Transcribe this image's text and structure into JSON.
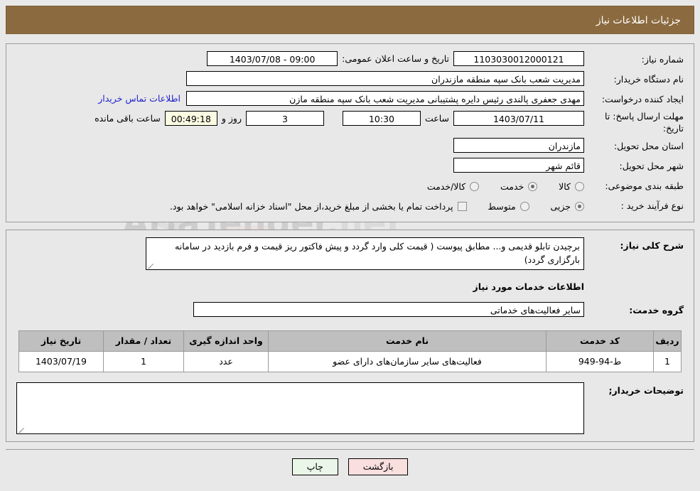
{
  "header": {
    "title": "جزئیات اطلاعات نیاز"
  },
  "form": {
    "need_number_label": "شماره نیاز:",
    "need_number_value": "1103030012000121",
    "announce_label": "تاریخ و ساعت اعلان عمومی:",
    "announce_value": "09:00 - 1403/07/08",
    "org_label": "نام دستگاه خریدار:",
    "org_value": "مدیریت شعب بانک سپه منطقه مازندران",
    "creator_label": "ایجاد کننده درخواست:",
    "creator_value": "مهدی جعفری پالندی رئیس دایره پشتیبانی مدیریت شعب بانک سپه منطقه مازن",
    "creator_link": "اطلاعات تماس خریدار",
    "deadline_label": "مهلت ارسال پاسخ: تا تاریخ:",
    "deadline_date": "1403/07/11",
    "deadline_time_label": "ساعت",
    "deadline_time": "10:30",
    "days_value": "3",
    "days_label": "روز و",
    "countdown_value": "00:49:18",
    "countdown_label": "ساعت باقی مانده",
    "province_label": "استان محل تحویل:",
    "province_value": "مازندران",
    "city_label": "شهر محل تحویل:",
    "city_value": "قائم شهر",
    "category_label": "طبقه بندی موضوعی:",
    "category_options": [
      {
        "label": "کالا",
        "selected": false
      },
      {
        "label": "خدمت",
        "selected": true
      },
      {
        "label": "کالا/خدمت",
        "selected": false
      }
    ],
    "process_label": "نوع فرآیند خرید :",
    "process_options": [
      {
        "label": "جزیی",
        "selected": true
      },
      {
        "label": "متوسط",
        "selected": false
      }
    ],
    "treasury_checkbox_label": "",
    "treasury_note": "پرداخت تمام یا بخشی از مبلغ خرید،از محل \"اسناد خزانه اسلامی\" خواهد بود."
  },
  "description": {
    "label": "شرح کلی نیاز:",
    "value": "برچیدن تابلو  قدیمی و... مطابق پیوست ( قیمت کلی وارد گردد و پیش فاکتور ریز قیمت و فرم بازدید در سامانه بارگزاری گردد)"
  },
  "services_section": {
    "title": "اطلاعات خدمات مورد نیاز",
    "group_label": "گروه خدمت:",
    "group_value": "سایر فعالیت‌های خدماتی"
  },
  "table": {
    "columns": [
      "ردیف",
      "کد خدمت",
      "نام خدمت",
      "واحد اندازه گیری",
      "تعداد / مقدار",
      "تاریخ نیاز"
    ],
    "rows": [
      {
        "radif": "1",
        "code": "ط-94-949",
        "name": "فعالیت‌های سایر سازمان‌های دارای عضو",
        "unit": "عدد",
        "qty": "1",
        "date": "1403/07/19"
      }
    ]
  },
  "buyer_notes": {
    "label": "توضیحات خریدار;",
    "value": ""
  },
  "footer": {
    "print_label": "چاپ",
    "back_label": "بازگشت"
  },
  "watermark": {
    "brand": "AriaTender",
    "suffix": ".net"
  },
  "colors": {
    "header_bg": "#8b6a3f",
    "page_bg": "#e8e8e8",
    "link": "#2222cc",
    "print_btn": "#eaf6e8",
    "back_btn": "#fadfdf",
    "table_header": "#bfbfbf"
  }
}
